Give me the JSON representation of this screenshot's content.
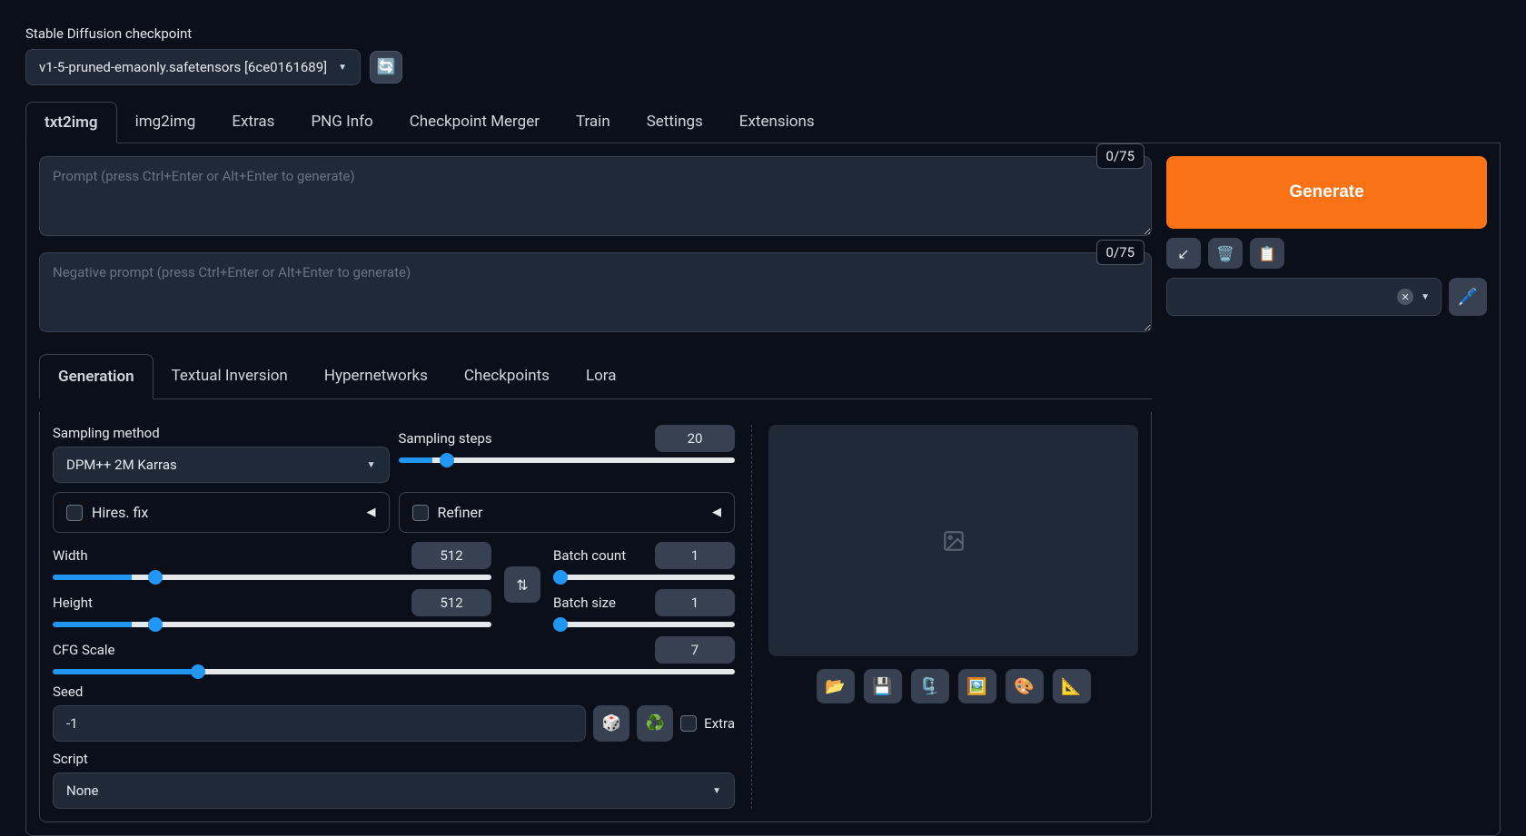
{
  "header": {
    "checkpoint_label": "Stable Diffusion checkpoint",
    "checkpoint_value": "v1-5-pruned-emaonly.safetensors [6ce0161689]"
  },
  "tabs": [
    "txt2img",
    "img2img",
    "Extras",
    "PNG Info",
    "Checkpoint Merger",
    "Train",
    "Settings",
    "Extensions"
  ],
  "active_tab": "txt2img",
  "prompt": {
    "placeholder": "Prompt (press Ctrl+Enter or Alt+Enter to generate)",
    "tokens": "0/75"
  },
  "negative_prompt": {
    "placeholder": "Negative prompt (press Ctrl+Enter or Alt+Enter to generate)",
    "tokens": "0/75"
  },
  "generate_label": "Generate",
  "sub_tabs": [
    "Generation",
    "Textual Inversion",
    "Hypernetworks",
    "Checkpoints",
    "Lora"
  ],
  "active_sub_tab": "Generation",
  "sampling": {
    "method_label": "Sampling method",
    "method_value": "DPM++ 2M Karras",
    "steps_label": "Sampling steps",
    "steps_value": "20"
  },
  "hires_label": "Hires. fix",
  "refiner_label": "Refiner",
  "dims": {
    "width_label": "Width",
    "width_value": "512",
    "height_label": "Height",
    "height_value": "512"
  },
  "batch": {
    "count_label": "Batch count",
    "count_value": "1",
    "size_label": "Batch size",
    "size_value": "1"
  },
  "cfg": {
    "label": "CFG Scale",
    "value": "7"
  },
  "seed": {
    "label": "Seed",
    "value": "-1",
    "extra_label": "Extra"
  },
  "script": {
    "label": "Script",
    "value": "None"
  }
}
